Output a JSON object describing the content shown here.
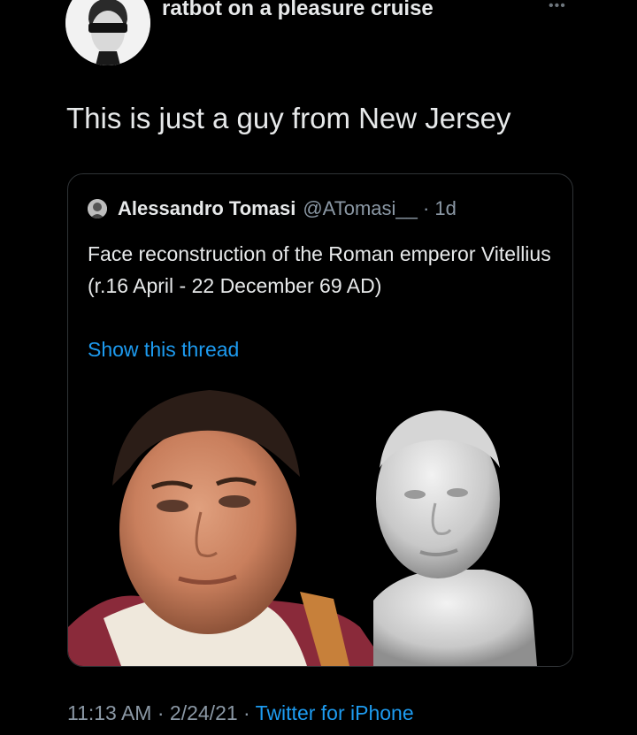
{
  "tweet": {
    "author_name": "ratbot on a pleasure cruise",
    "more_icon": "more-icon",
    "text": "This is just a guy from New Jersey",
    "timestamp": "11:13 AM · 2/24/21 · ",
    "source": "Twitter for iPhone"
  },
  "quoted_tweet": {
    "author_name": "Alessandro Tomasi",
    "meta": "@ATomasi__ · 1d",
    "text": "Face reconstruction of the Roman emperor Vitellius (r.16 April - 22 December 69 AD)",
    "link_label": "Show this thread"
  },
  "colors": {
    "background": "#000000",
    "text": "#e7e9ea",
    "secondary_text": "#8b98a5",
    "link": "#1d9bf0",
    "border": "#2f3336"
  }
}
